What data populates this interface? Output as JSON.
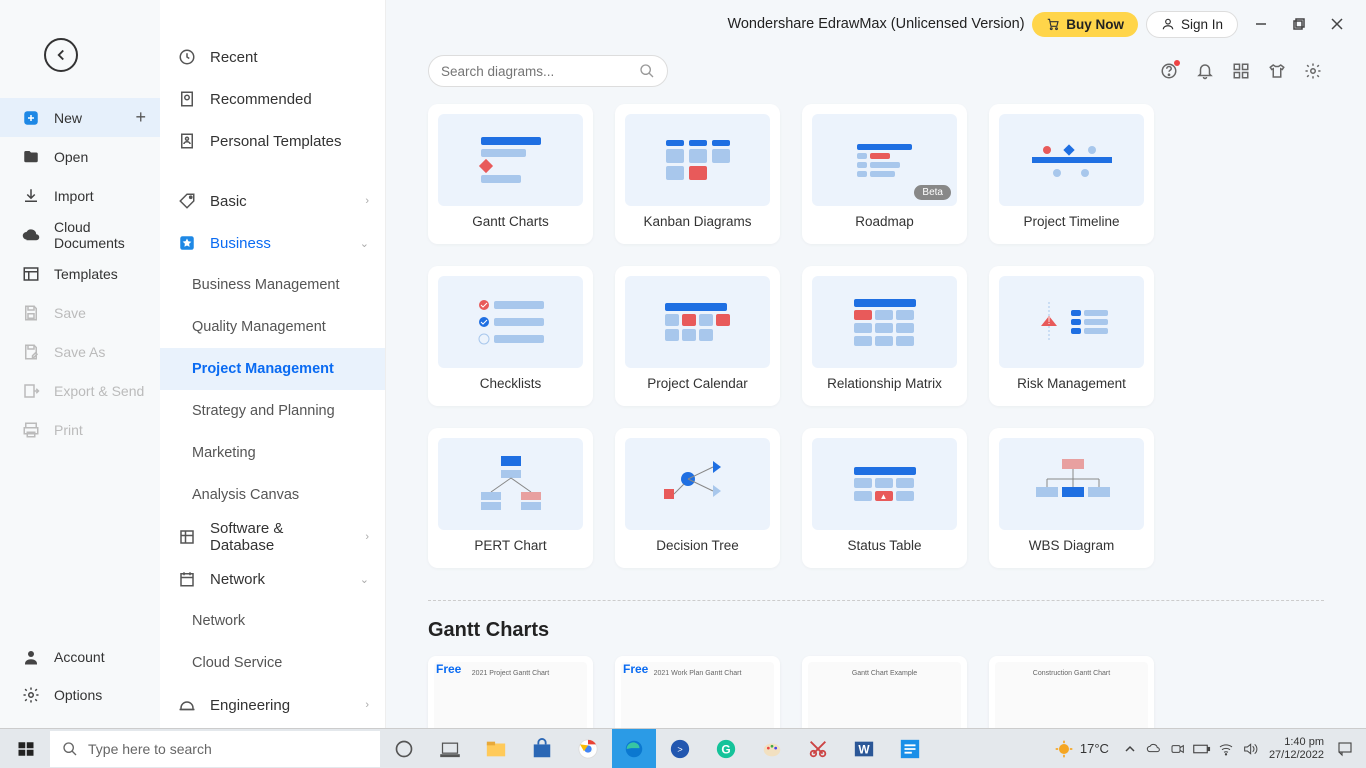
{
  "app": {
    "title": "Wondershare EdrawMax (Unlicensed Version)",
    "buy_label": "Buy Now",
    "signin_label": "Sign In"
  },
  "search": {
    "placeholder": "Search diagrams..."
  },
  "sidebar_left": {
    "items": [
      {
        "label": "New",
        "icon": "plus-square",
        "selected": true,
        "showPlus": true
      },
      {
        "label": "Open",
        "icon": "folder"
      },
      {
        "label": "Import",
        "icon": "import"
      },
      {
        "label": "Cloud Documents",
        "icon": "cloud"
      },
      {
        "label": "Templates",
        "icon": "templates"
      },
      {
        "label": "Save",
        "icon": "save",
        "disabled": true
      },
      {
        "label": "Save As",
        "icon": "save-as",
        "disabled": true
      },
      {
        "label": "Export & Send",
        "icon": "export",
        "disabled": true
      },
      {
        "label": "Print",
        "icon": "print",
        "disabled": true
      }
    ],
    "bottom": [
      {
        "label": "Account",
        "icon": "person"
      },
      {
        "label": "Options",
        "icon": "gear"
      }
    ]
  },
  "sidebar_mid": {
    "top": [
      {
        "label": "Recent",
        "icon": "clock"
      },
      {
        "label": "Recommended",
        "icon": "badge"
      },
      {
        "label": "Personal Templates",
        "icon": "person-doc"
      }
    ],
    "categories": [
      {
        "label": "Basic",
        "icon": "tag",
        "chev": "right"
      },
      {
        "label": "Business",
        "icon": "star",
        "chev": "down",
        "active": true,
        "subs": [
          {
            "label": "Business Management"
          },
          {
            "label": "Quality Management"
          },
          {
            "label": "Project Management",
            "selected": true
          },
          {
            "label": "Strategy and Planning"
          },
          {
            "label": "Marketing"
          },
          {
            "label": "Analysis Canvas"
          }
        ]
      },
      {
        "label": "Software & Database",
        "icon": "db",
        "chev": "right"
      },
      {
        "label": "Network",
        "icon": "calendar",
        "chev": "down",
        "subs": [
          {
            "label": "Network"
          },
          {
            "label": "Cloud Service"
          }
        ]
      },
      {
        "label": "Engineering",
        "icon": "helmet",
        "chev": "right"
      }
    ]
  },
  "cards": [
    {
      "label": "Gantt Charts"
    },
    {
      "label": "Kanban Diagrams"
    },
    {
      "label": "Roadmap",
      "badge": "Beta"
    },
    {
      "label": "Project Timeline"
    },
    {
      "label": "Checklists"
    },
    {
      "label": "Project Calendar"
    },
    {
      "label": "Relationship Matrix"
    },
    {
      "label": "Risk Management"
    },
    {
      "label": "PERT Chart"
    },
    {
      "label": "Decision Tree"
    },
    {
      "label": "Status Table"
    },
    {
      "label": "WBS Diagram"
    }
  ],
  "section": {
    "title": "Gantt Charts"
  },
  "templates_row": [
    {
      "free": "Free",
      "caption": "2021 Project Gantt Chart"
    },
    {
      "free": "Free",
      "caption": "2021 Work Plan Gantt Chart"
    },
    {
      "caption": "Gantt Chart Example"
    },
    {
      "caption": "Construction Gantt Chart"
    }
  ],
  "taskbar": {
    "search_placeholder": "Type here to search",
    "weather_temp": "17°C",
    "time": "1:40 pm",
    "date": "27/12/2022"
  }
}
